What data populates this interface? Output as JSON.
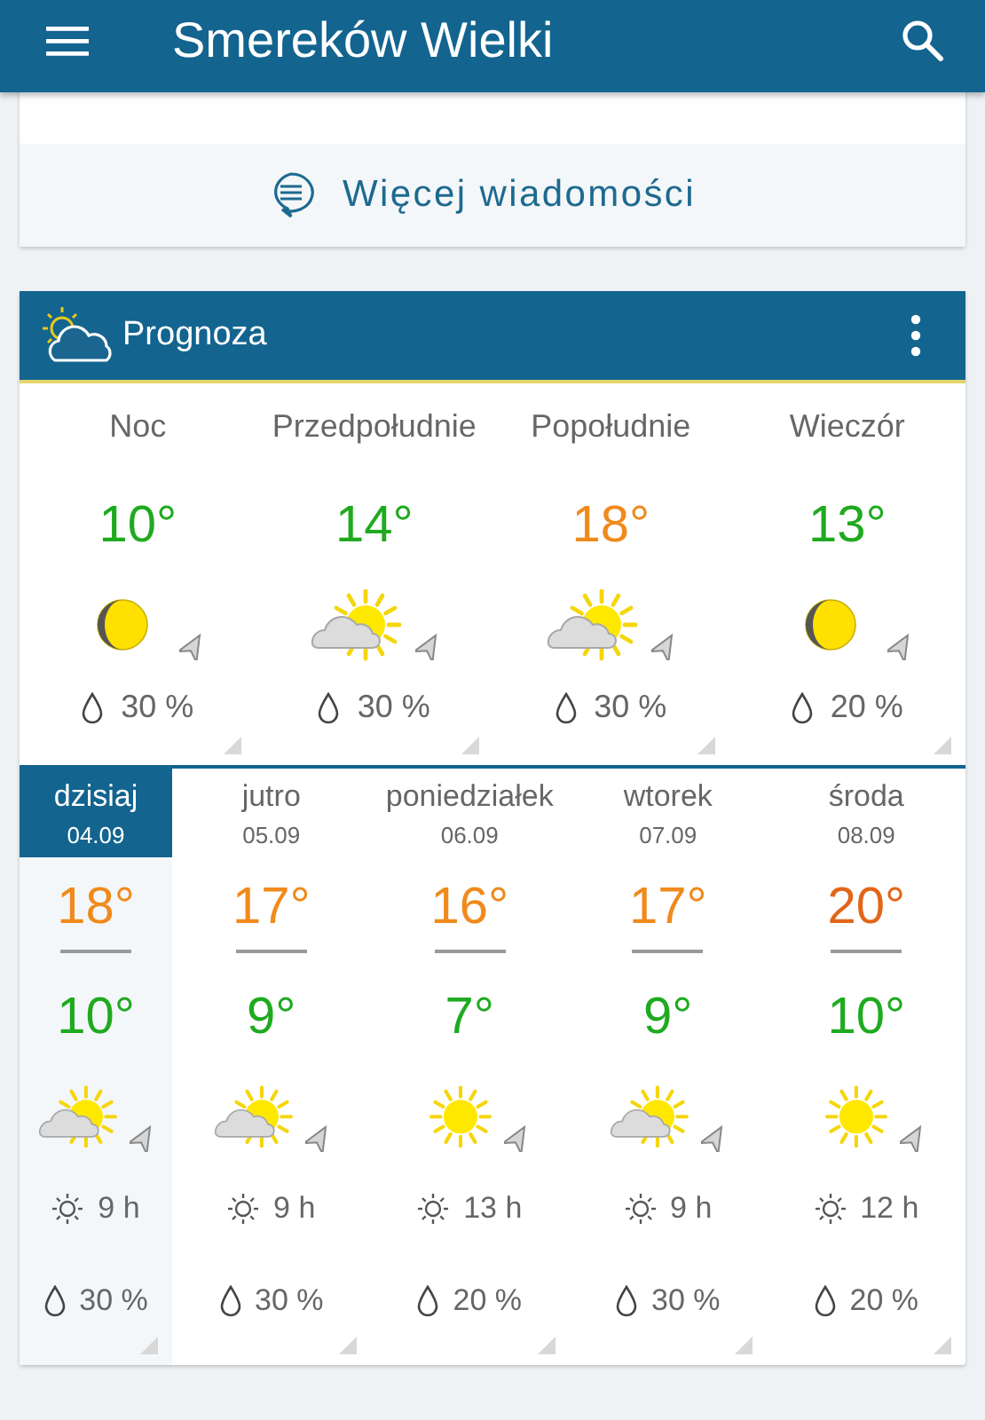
{
  "app_bar": {
    "title": "Smereków Wielki"
  },
  "news_card": {
    "more_link": "Więcej wiadomości"
  },
  "forecast_card": {
    "title": "Prognoza",
    "parts_of_day": [
      {
        "label": "Noc",
        "temp": "10°",
        "color": "#1faa1f",
        "kind": "moon",
        "rain": "30 %"
      },
      {
        "label": "Przedpołudnie",
        "temp": "14°",
        "color": "#1faa1f",
        "kind": "partly-cloudy",
        "rain": "30 %"
      },
      {
        "label": "Popołudnie",
        "temp": "18°",
        "color": "#f08a1c",
        "kind": "partly-cloudy",
        "rain": "30 %"
      },
      {
        "label": "Wieczór",
        "temp": "13°",
        "color": "#1faa1f",
        "kind": "moon",
        "rain": "20 %"
      }
    ],
    "days": [
      {
        "name": "dzisiaj",
        "date": "04.09",
        "selected": true,
        "high": {
          "value": "18°",
          "color": "#f08a1c"
        },
        "low": {
          "value": "10°",
          "color": "#1faa1f"
        },
        "kind": "partly-cloudy",
        "sun_hours": "9 h",
        "rain": "30 %"
      },
      {
        "name": "jutro",
        "date": "05.09",
        "selected": false,
        "high": {
          "value": "17°",
          "color": "#f08a1c"
        },
        "low": {
          "value": "9°",
          "color": "#1faa1f"
        },
        "kind": "partly-cloudy",
        "sun_hours": "9 h",
        "rain": "30 %"
      },
      {
        "name": "poniedziałek",
        "date": "06.09",
        "selected": false,
        "high": {
          "value": "16°",
          "color": "#f08a1c"
        },
        "low": {
          "value": "7°",
          "color": "#1faa1f"
        },
        "kind": "sunny",
        "sun_hours": "13 h",
        "rain": "20 %"
      },
      {
        "name": "wtorek",
        "date": "07.09",
        "selected": false,
        "high": {
          "value": "17°",
          "color": "#f08a1c"
        },
        "low": {
          "value": "9°",
          "color": "#1faa1f"
        },
        "kind": "partly-cloudy",
        "sun_hours": "9 h",
        "rain": "30 %"
      },
      {
        "name": "środa",
        "date": "08.09",
        "selected": false,
        "high": {
          "value": "20°",
          "color": "#e2661a"
        },
        "low": {
          "value": "10°",
          "color": "#1faa1f"
        },
        "kind": "sunny",
        "sun_hours": "12 h",
        "rain": "20 %"
      }
    ]
  }
}
